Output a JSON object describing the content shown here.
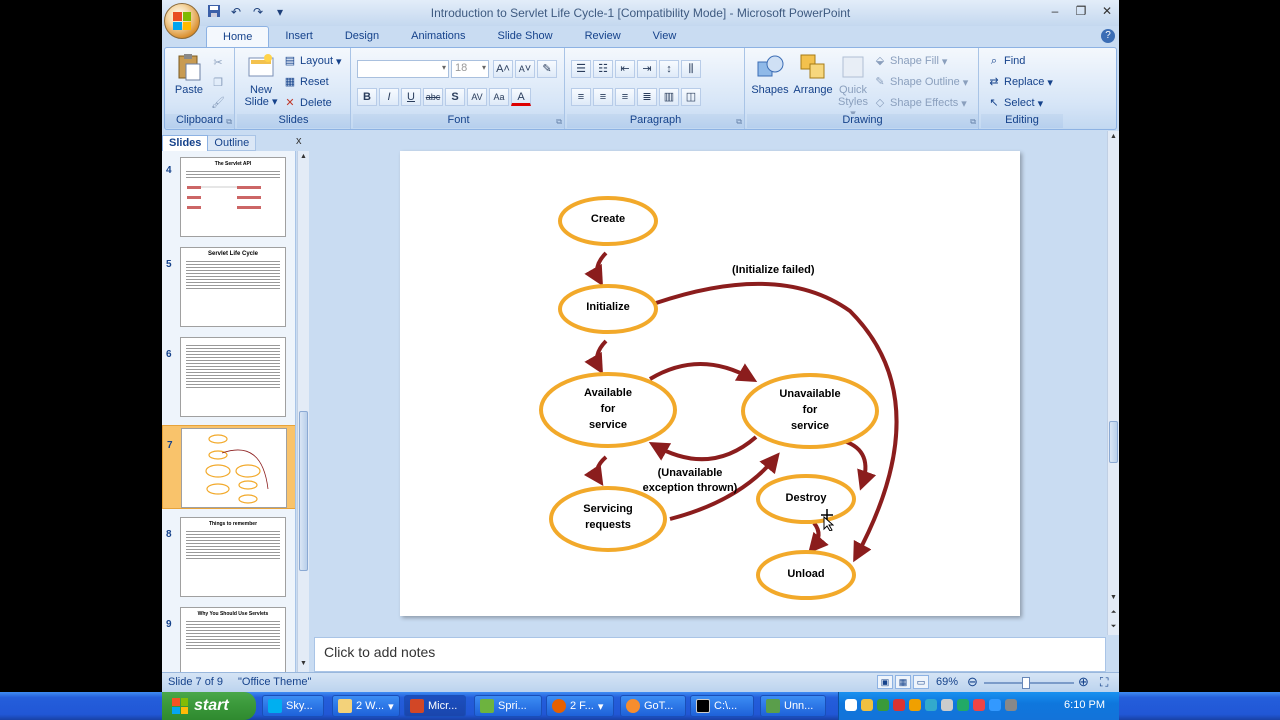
{
  "window": {
    "title": "Introduction to Servlet Life Cycle-1 [Compatibility Mode] - Microsoft PowerPoint"
  },
  "ribbon": {
    "tabs": [
      "Home",
      "Insert",
      "Design",
      "Animations",
      "Slide Show",
      "Review",
      "View"
    ],
    "active_tab": "Home",
    "clipboard": {
      "label": "Clipboard",
      "paste": "Paste"
    },
    "slides": {
      "label": "Slides",
      "new_slide_1": "New",
      "new_slide_2": "Slide",
      "layout": "Layout",
      "reset": "Reset",
      "delete": "Delete"
    },
    "font": {
      "label": "Font",
      "size": "18",
      "bold": "B",
      "italic": "I",
      "underline": "U",
      "strike": "abc",
      "shadow": "S",
      "spacing": "AV",
      "case": "Aa",
      "color": "A",
      "grow": "A",
      "shrink": "A"
    },
    "paragraph": {
      "label": "Paragraph"
    },
    "drawing": {
      "label": "Drawing",
      "shapes": "Shapes",
      "arrange": "Arrange",
      "quick_styles_1": "Quick",
      "quick_styles_2": "Styles",
      "shape_fill": "Shape Fill",
      "shape_outline": "Shape Outline",
      "shape_effects": "Shape Effects"
    },
    "editing": {
      "label": "Editing",
      "find": "Find",
      "replace": "Replace",
      "select": "Select"
    }
  },
  "slides_pane": {
    "tab_slides": "Slides",
    "tab_outline": "Outline",
    "close": "x",
    "thumbnails": [
      {
        "num": "4",
        "title": "The Servlet API"
      },
      {
        "num": "5",
        "title": "Servlet Life Cycle"
      },
      {
        "num": "6",
        "title": ""
      },
      {
        "num": "7",
        "title": ""
      },
      {
        "num": "8",
        "title": "Things to remember"
      },
      {
        "num": "9",
        "title": "Why You Should Use Servlets"
      }
    ],
    "selected": "7"
  },
  "slide": {
    "nodes": {
      "create": "Create",
      "initialize": "Initialize",
      "available_1": "Available",
      "available_2": "for",
      "available_3": "service",
      "unavailable_1": "Unavailable",
      "unavailable_2": "for",
      "unavailable_3": "service",
      "servicing_1": "Servicing",
      "servicing_2": "requests",
      "destroy": "Destroy",
      "unload": "Unload"
    },
    "captions": {
      "init_failed": "(Initialize failed)",
      "unavail_1": "(Unavailable",
      "unavail_2": "exception thrown)"
    }
  },
  "notes": {
    "placeholder": "Click to add notes"
  },
  "status": {
    "slide": "Slide 7 of 9",
    "theme": "\"Office Theme\"",
    "zoom": "69%"
  },
  "taskbar": {
    "start": "start",
    "tasks": [
      "Sky...",
      "2 W...",
      "Micr...",
      "Spri...",
      "2 F...",
      "GoT...",
      "C:\\...",
      "Unn..."
    ],
    "clock": "6:10 PM"
  },
  "colors": {
    "ellipse": "#f2a92a",
    "arrow": "#8b1d1d"
  }
}
